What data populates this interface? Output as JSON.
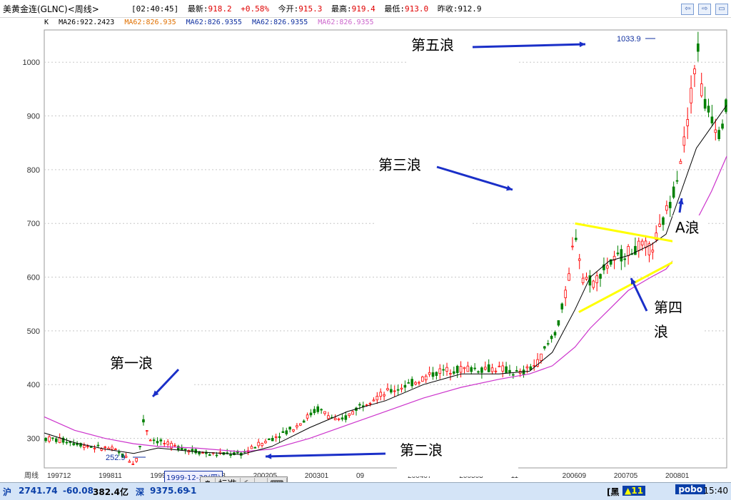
{
  "header": {
    "name": "美黄金连(GLNC)<周线>",
    "time": "[02:40:45]",
    "latest_label": "最新:",
    "latest": "918.2",
    "change": "+0.58%",
    "open_label": "今开:",
    "open": "915.3",
    "high_label": "最高:",
    "high": "919.4",
    "low_label": "最低:",
    "low": "913.0",
    "prev_label": "昨收:",
    "prev": "912.9"
  },
  "window_buttons": [
    "⇦",
    "⇨",
    "▭"
  ],
  "ma_bar": {
    "k": "K",
    "ma1": "MA26:922.2423",
    "ma2": "MA62:826.935",
    "ma3": "MA62:826.9355",
    "ma4": "MA62:826.9355",
    "ma5": "MA62:826.9355"
  },
  "colors": {
    "up": "#ff0000",
    "down": "#008000",
    "ma26": "#000000",
    "ma62": "#cc33cc",
    "trend": "#ffff00",
    "arrow": "#1a2fc8",
    "axis": "#555555"
  },
  "status": {
    "sh_label": "沪",
    "sh_index": "2741.74",
    "sh_change": "-60.08",
    "sh_amount": "382.4亿",
    "sz_label": "深",
    "sz_index": "9375.69",
    "sz_change": "-1",
    "right_a": "[黑",
    "right_b": "▲11",
    "brand": "pobo",
    "clock": "15:40"
  },
  "toolbar": {
    "mode": "标准"
  },
  "cursor_date": "1999-12-30(四)",
  "chart_data": {
    "type": "candlestick",
    "period_label": "周线",
    "xlabels": [
      "199712",
      "199811",
      "199907",
      "200108",
      "200205",
      "200301",
      "09",
      "200407",
      "200503",
      "11",
      "200609",
      "200705",
      "200801"
    ],
    "yticks": [
      300,
      400,
      500,
      600,
      700,
      800,
      900,
      1000
    ],
    "ylim": [
      245,
      1060
    ],
    "series": [
      {
        "name": "MA26"
      },
      {
        "name": "MA62"
      }
    ],
    "price_path": [
      [
        0,
        300
      ],
      [
        30,
        295
      ],
      [
        60,
        285
      ],
      [
        90,
        280
      ],
      [
        110,
        262
      ],
      [
        118,
        253
      ],
      [
        125,
        270
      ],
      [
        130,
        335
      ],
      [
        140,
        300
      ],
      [
        170,
        285
      ],
      [
        220,
        270
      ],
      [
        260,
        272
      ],
      [
        300,
        300
      ],
      [
        330,
        320
      ],
      [
        360,
        355
      ],
      [
        390,
        330
      ],
      [
        420,
        365
      ],
      [
        450,
        385
      ],
      [
        480,
        400
      ],
      [
        520,
        425
      ],
      [
        560,
        430
      ],
      [
        600,
        430
      ],
      [
        630,
        420
      ],
      [
        650,
        440
      ],
      [
        675,
        500
      ],
      [
        690,
        580
      ],
      [
        700,
        690
      ],
      [
        710,
        600
      ],
      [
        725,
        590
      ],
      [
        740,
        620
      ],
      [
        760,
        640
      ],
      [
        790,
        660
      ],
      [
        800,
        650
      ],
      [
        815,
        700
      ],
      [
        830,
        760
      ],
      [
        845,
        860
      ],
      [
        855,
        960
      ],
      [
        862,
        1033
      ],
      [
        868,
        930
      ],
      [
        880,
        900
      ],
      [
        890,
        870
      ],
      [
        900,
        920
      ]
    ],
    "ma26_path": [
      [
        0,
        310
      ],
      [
        40,
        292
      ],
      [
        80,
        280
      ],
      [
        118,
        272
      ],
      [
        150,
        282
      ],
      [
        200,
        275
      ],
      [
        260,
        270
      ],
      [
        300,
        285
      ],
      [
        350,
        320
      ],
      [
        400,
        350
      ],
      [
        450,
        370
      ],
      [
        500,
        400
      ],
      [
        550,
        420
      ],
      [
        600,
        420
      ],
      [
        640,
        425
      ],
      [
        670,
        460
      ],
      [
        700,
        540
      ],
      [
        720,
        600
      ],
      [
        745,
        630
      ],
      [
        770,
        640
      ],
      [
        800,
        660
      ],
      [
        820,
        680
      ],
      [
        840,
        760
      ],
      [
        860,
        840
      ],
      [
        880,
        880
      ],
      [
        900,
        920
      ]
    ],
    "ma62_path": [
      [
        0,
        340
      ],
      [
        40,
        315
      ],
      [
        80,
        300
      ],
      [
        118,
        290
      ],
      [
        150,
        285
      ],
      [
        200,
        282
      ],
      [
        260,
        275
      ],
      [
        300,
        280
      ],
      [
        350,
        300
      ],
      [
        400,
        325
      ],
      [
        450,
        350
      ],
      [
        500,
        375
      ],
      [
        550,
        395
      ],
      [
        600,
        410
      ],
      [
        640,
        420
      ],
      [
        670,
        435
      ],
      [
        700,
        470
      ],
      [
        720,
        505
      ],
      [
        745,
        540
      ],
      [
        770,
        575
      ],
      [
        800,
        600
      ],
      [
        820,
        615
      ],
      [
        840,
        650
      ],
      [
        860,
        705
      ],
      [
        880,
        760
      ],
      [
        900,
        825
      ]
    ],
    "annotations": [
      {
        "text": "第一浪"
      },
      {
        "text": "第二浪"
      },
      {
        "text": "第三浪"
      },
      {
        "text": "第四浪"
      },
      {
        "text": "第五浪"
      },
      {
        "text": "A浪"
      },
      {
        "text": "1033.9"
      },
      {
        "text": "252.9"
      }
    ]
  }
}
